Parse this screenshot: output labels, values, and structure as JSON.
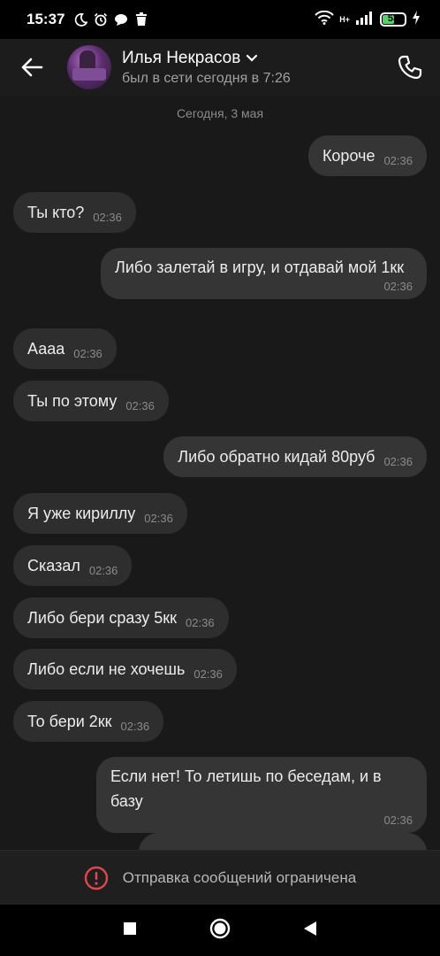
{
  "status_bar": {
    "time": "15:37",
    "network": "H+",
    "battery": "53",
    "battery_level": 0.53
  },
  "header": {
    "contact_name": "Илья Некрасов",
    "last_seen": "был в сети сегодня в 7:26"
  },
  "chat": {
    "date_separator": "Сегодня, 3 мая",
    "messages": [
      {
        "direction": "out",
        "text": "Короче",
        "time": "02:36"
      },
      {
        "direction": "in",
        "text": "Ты кто?",
        "time": "02:36"
      },
      {
        "direction": "out",
        "text": "Либо залетай в игру, и отдавай мой 1кк",
        "time": "02:36"
      },
      {
        "direction": "in",
        "text": "Аааа",
        "time": "02:36"
      },
      {
        "direction": "in",
        "text": "Ты по этому",
        "time": "02:36"
      },
      {
        "direction": "out",
        "text": "Либо обратно кидай 80руб",
        "time": "02:36"
      },
      {
        "direction": "in",
        "text": "Я уже кириллу",
        "time": "02:36"
      },
      {
        "direction": "in",
        "text": "Сказал",
        "time": "02:36"
      },
      {
        "direction": "in",
        "text": "Либо бери сразу 5кк",
        "time": "02:36"
      },
      {
        "direction": "in",
        "text": "Либо если не хочешь",
        "time": "02:36"
      },
      {
        "direction": "in",
        "text": "То бери 2кк",
        "time": "02:36"
      },
      {
        "direction": "out",
        "text": "Если нет! То летишь по беседам, и в базу",
        "time": "02:36"
      }
    ]
  },
  "bottom": {
    "restricted_text": "Отправка сообщений ограничена"
  },
  "colors": {
    "background": "#191919",
    "bubble": "#2e2e2e",
    "alert_red": "#e0464a",
    "battery_green": "#53d36a"
  },
  "icons": {
    "back": "arrow-left-icon",
    "call": "phone-icon",
    "alert": "alert-circle-icon",
    "nav_recent": "square-icon",
    "nav_home": "circle-icon",
    "nav_back": "triangle-left-icon"
  }
}
